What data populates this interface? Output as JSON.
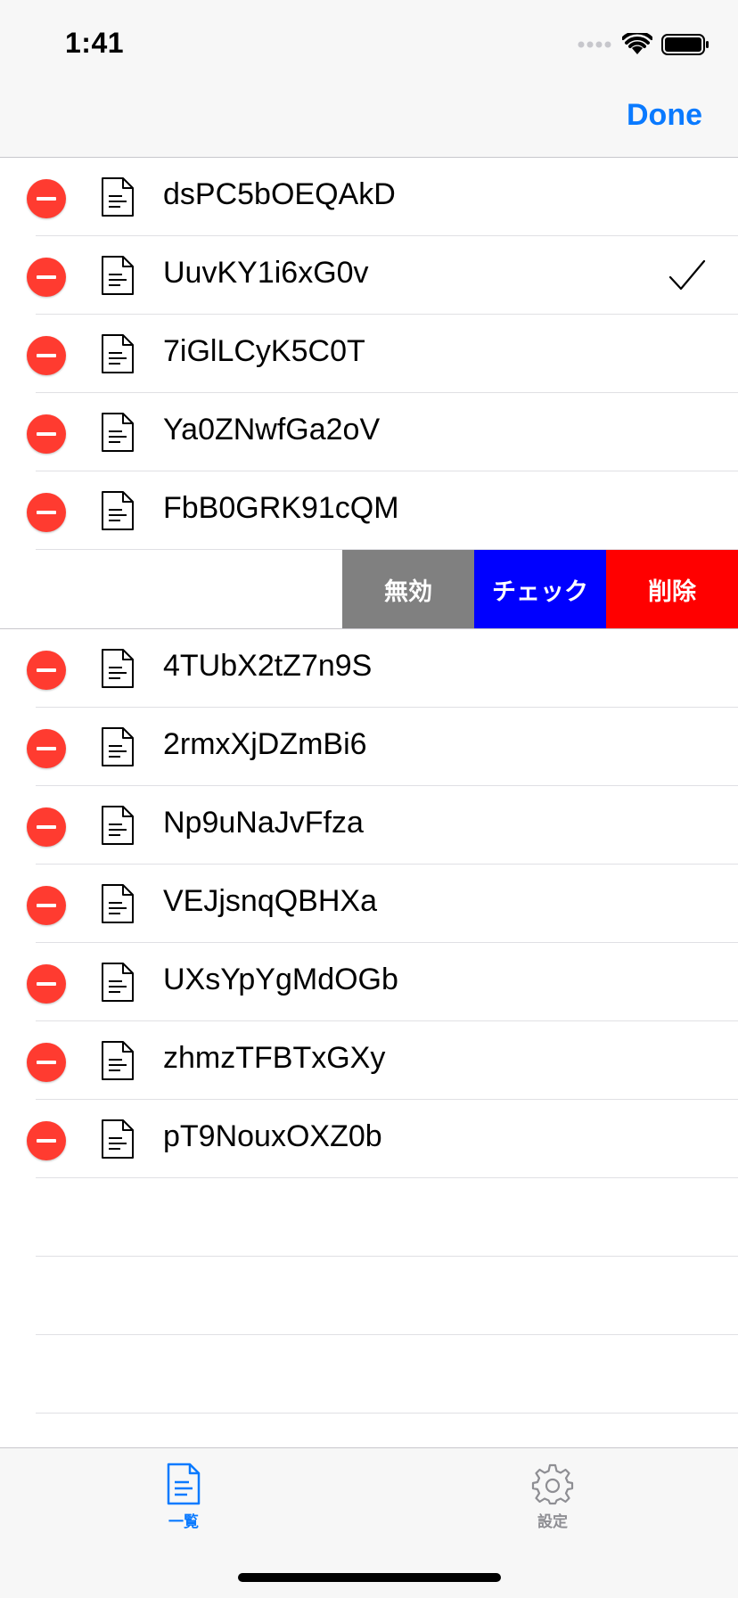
{
  "status_bar": {
    "time": "1:41"
  },
  "nav": {
    "done_label": "Done"
  },
  "rows_top": [
    {
      "label": "dsPC5bOEQAkD",
      "checked": false
    },
    {
      "label": "UuvKY1i6xG0v",
      "checked": true
    },
    {
      "label": "7iGlLCyK5C0T",
      "checked": false
    },
    {
      "label": "Ya0ZNwfGa2oV",
      "checked": false
    },
    {
      "label": "FbB0GRK91cQM",
      "checked": false
    }
  ],
  "swipe_actions": [
    {
      "label": "無効",
      "color": "#808080"
    },
    {
      "label": "チェック",
      "color": "#0000ff"
    },
    {
      "label": "削除",
      "color": "#ff0000"
    }
  ],
  "rows_bottom": [
    {
      "label": "4TUbX2tZ7n9S"
    },
    {
      "label": "2rmxXjDZmBi6"
    },
    {
      "label": "Np9uNaJvFfza"
    },
    {
      "label": "VEJjsnqQBHXa"
    },
    {
      "label": "UXsYpYgMdOGb"
    },
    {
      "label": "zhmzTFBTxGXy"
    },
    {
      "label": "pT9NouxOXZ0b"
    }
  ],
  "tabs": [
    {
      "label": "一覧",
      "icon": "document-icon",
      "active": true
    },
    {
      "label": "設定",
      "icon": "gear-icon",
      "active": false
    }
  ],
  "colors": {
    "accent": "#0a7aff",
    "delete_red": "#ff3b30",
    "inactive_tab": "#8e8e93"
  }
}
